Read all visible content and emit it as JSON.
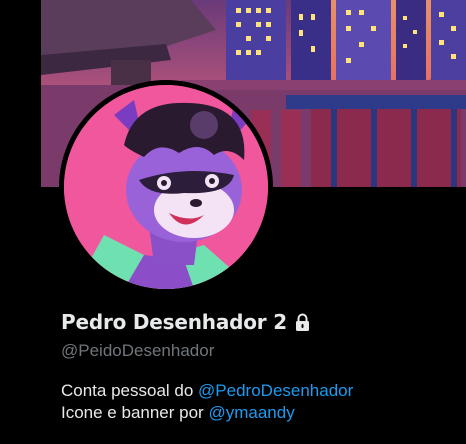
{
  "profile": {
    "display_name": "Pedro Desenhador 2",
    "handle": "@PeidoDesenhador",
    "bio": {
      "line1_text": "Conta pessoal do ",
      "line1_mention": "@PedroDesenhador",
      "line2_text": "Icone e banner por ",
      "line2_mention": "@ymaandy"
    }
  },
  "icons": {
    "protected": "lock-icon"
  },
  "colors": {
    "background": "#000000",
    "text_primary": "#e7e9ea",
    "text_secondary": "#71767b",
    "link": "#1d9bf0",
    "avatar_bg": "#f0579c"
  }
}
